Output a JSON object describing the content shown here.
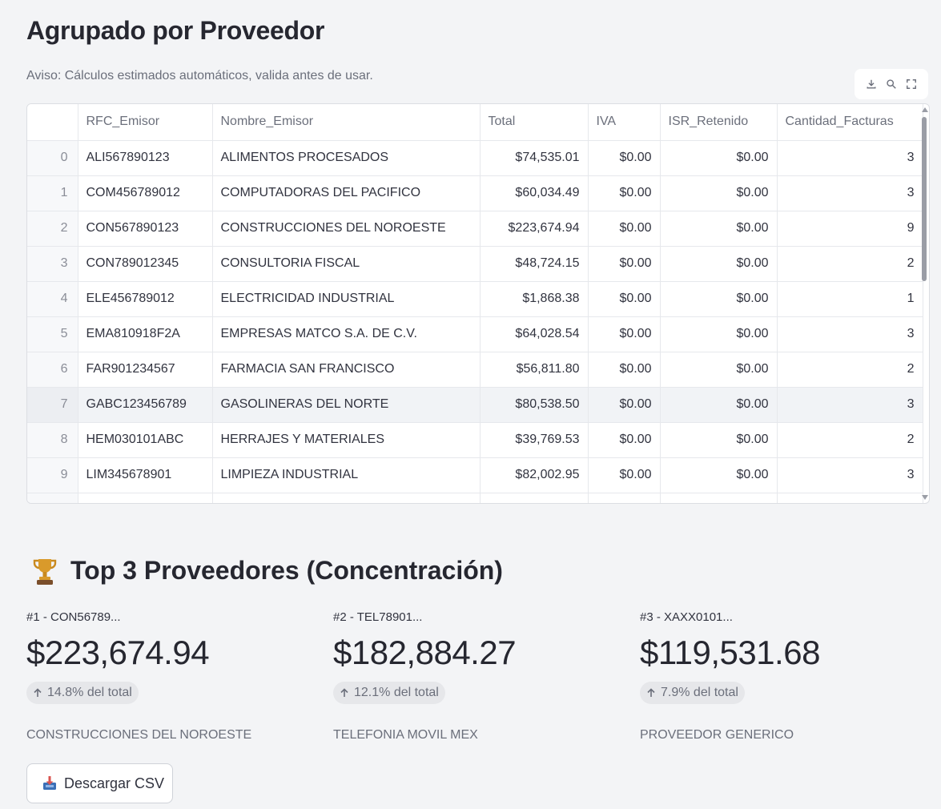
{
  "header": {
    "title": "Agrupado por Proveedor",
    "notice": "Aviso: Cálculos estimados automáticos, valida antes de usar."
  },
  "toolbar": {
    "icons": [
      "download-icon",
      "search-icon",
      "fullscreen-icon"
    ]
  },
  "table": {
    "columns": [
      "",
      "RFC_Emisor",
      "Nombre_Emisor",
      "Total",
      "IVA",
      "ISR_Retenido",
      "Cantidad_Facturas"
    ],
    "rows": [
      {
        "index": "0",
        "rfc": "ALI567890123",
        "nombre": "ALIMENTOS PROCESADOS",
        "total": "$74,535.01",
        "iva": "$0.00",
        "isr": "$0.00",
        "cantidad": "3"
      },
      {
        "index": "1",
        "rfc": "COM456789012",
        "nombre": "COMPUTADORAS DEL PACIFICO",
        "total": "$60,034.49",
        "iva": "$0.00",
        "isr": "$0.00",
        "cantidad": "3"
      },
      {
        "index": "2",
        "rfc": "CON567890123",
        "nombre": "CONSTRUCCIONES DEL NOROESTE",
        "total": "$223,674.94",
        "iva": "$0.00",
        "isr": "$0.00",
        "cantidad": "9"
      },
      {
        "index": "3",
        "rfc": "CON789012345",
        "nombre": "CONSULTORIA FISCAL",
        "total": "$48,724.15",
        "iva": "$0.00",
        "isr": "$0.00",
        "cantidad": "2"
      },
      {
        "index": "4",
        "rfc": "ELE456789012",
        "nombre": "ELECTRICIDAD INDUSTRIAL",
        "total": "$1,868.38",
        "iva": "$0.00",
        "isr": "$0.00",
        "cantidad": "1"
      },
      {
        "index": "5",
        "rfc": "EMA810918F2A",
        "nombre": "EMPRESAS MATCO S.A. DE C.V.",
        "total": "$64,028.54",
        "iva": "$0.00",
        "isr": "$0.00",
        "cantidad": "3"
      },
      {
        "index": "6",
        "rfc": "FAR901234567",
        "nombre": "FARMACIA SAN FRANCISCO",
        "total": "$56,811.80",
        "iva": "$0.00",
        "isr": "$0.00",
        "cantidad": "2"
      },
      {
        "index": "7",
        "rfc": "GABC123456789",
        "nombre": "GASOLINERAS DEL NORTE",
        "total": "$80,538.50",
        "iva": "$0.00",
        "isr": "$0.00",
        "cantidad": "3"
      },
      {
        "index": "8",
        "rfc": "HEM030101ABC",
        "nombre": "HERRAJES Y MATERIALES",
        "total": "$39,769.53",
        "iva": "$0.00",
        "isr": "$0.00",
        "cantidad": "2"
      },
      {
        "index": "9",
        "rfc": "LIM345678901",
        "nombre": "LIMPIEZA INDUSTRIAL",
        "total": "$82,002.95",
        "iva": "$0.00",
        "isr": "$0.00",
        "cantidad": "3"
      }
    ],
    "hover_row": "7"
  },
  "top3": {
    "title": "Top 3 Proveedores (Concentración)",
    "icon": "trophy-icon",
    "metrics": [
      {
        "label": "#1 - CON56789...",
        "value": "$223,674.94",
        "delta": "14.8% del total",
        "name": "CONSTRUCCIONES DEL NOROESTE"
      },
      {
        "label": "#2 - TEL78901...",
        "value": "$182,884.27",
        "delta": "12.1% del total",
        "name": "TELEFONIA MOVIL MEX"
      },
      {
        "label": "#3 - XAXX0101...",
        "value": "$119,531.68",
        "delta": "7.9% del total",
        "name": "PROVEEDOR GENERICO"
      }
    ]
  },
  "download": {
    "label": "Descargar CSV",
    "icon": "inbox-tray-icon"
  },
  "colors": {
    "background": "#f3f4f6",
    "text": "#31333f",
    "muted": "#6b6f7b",
    "border": "#dcdee3"
  }
}
